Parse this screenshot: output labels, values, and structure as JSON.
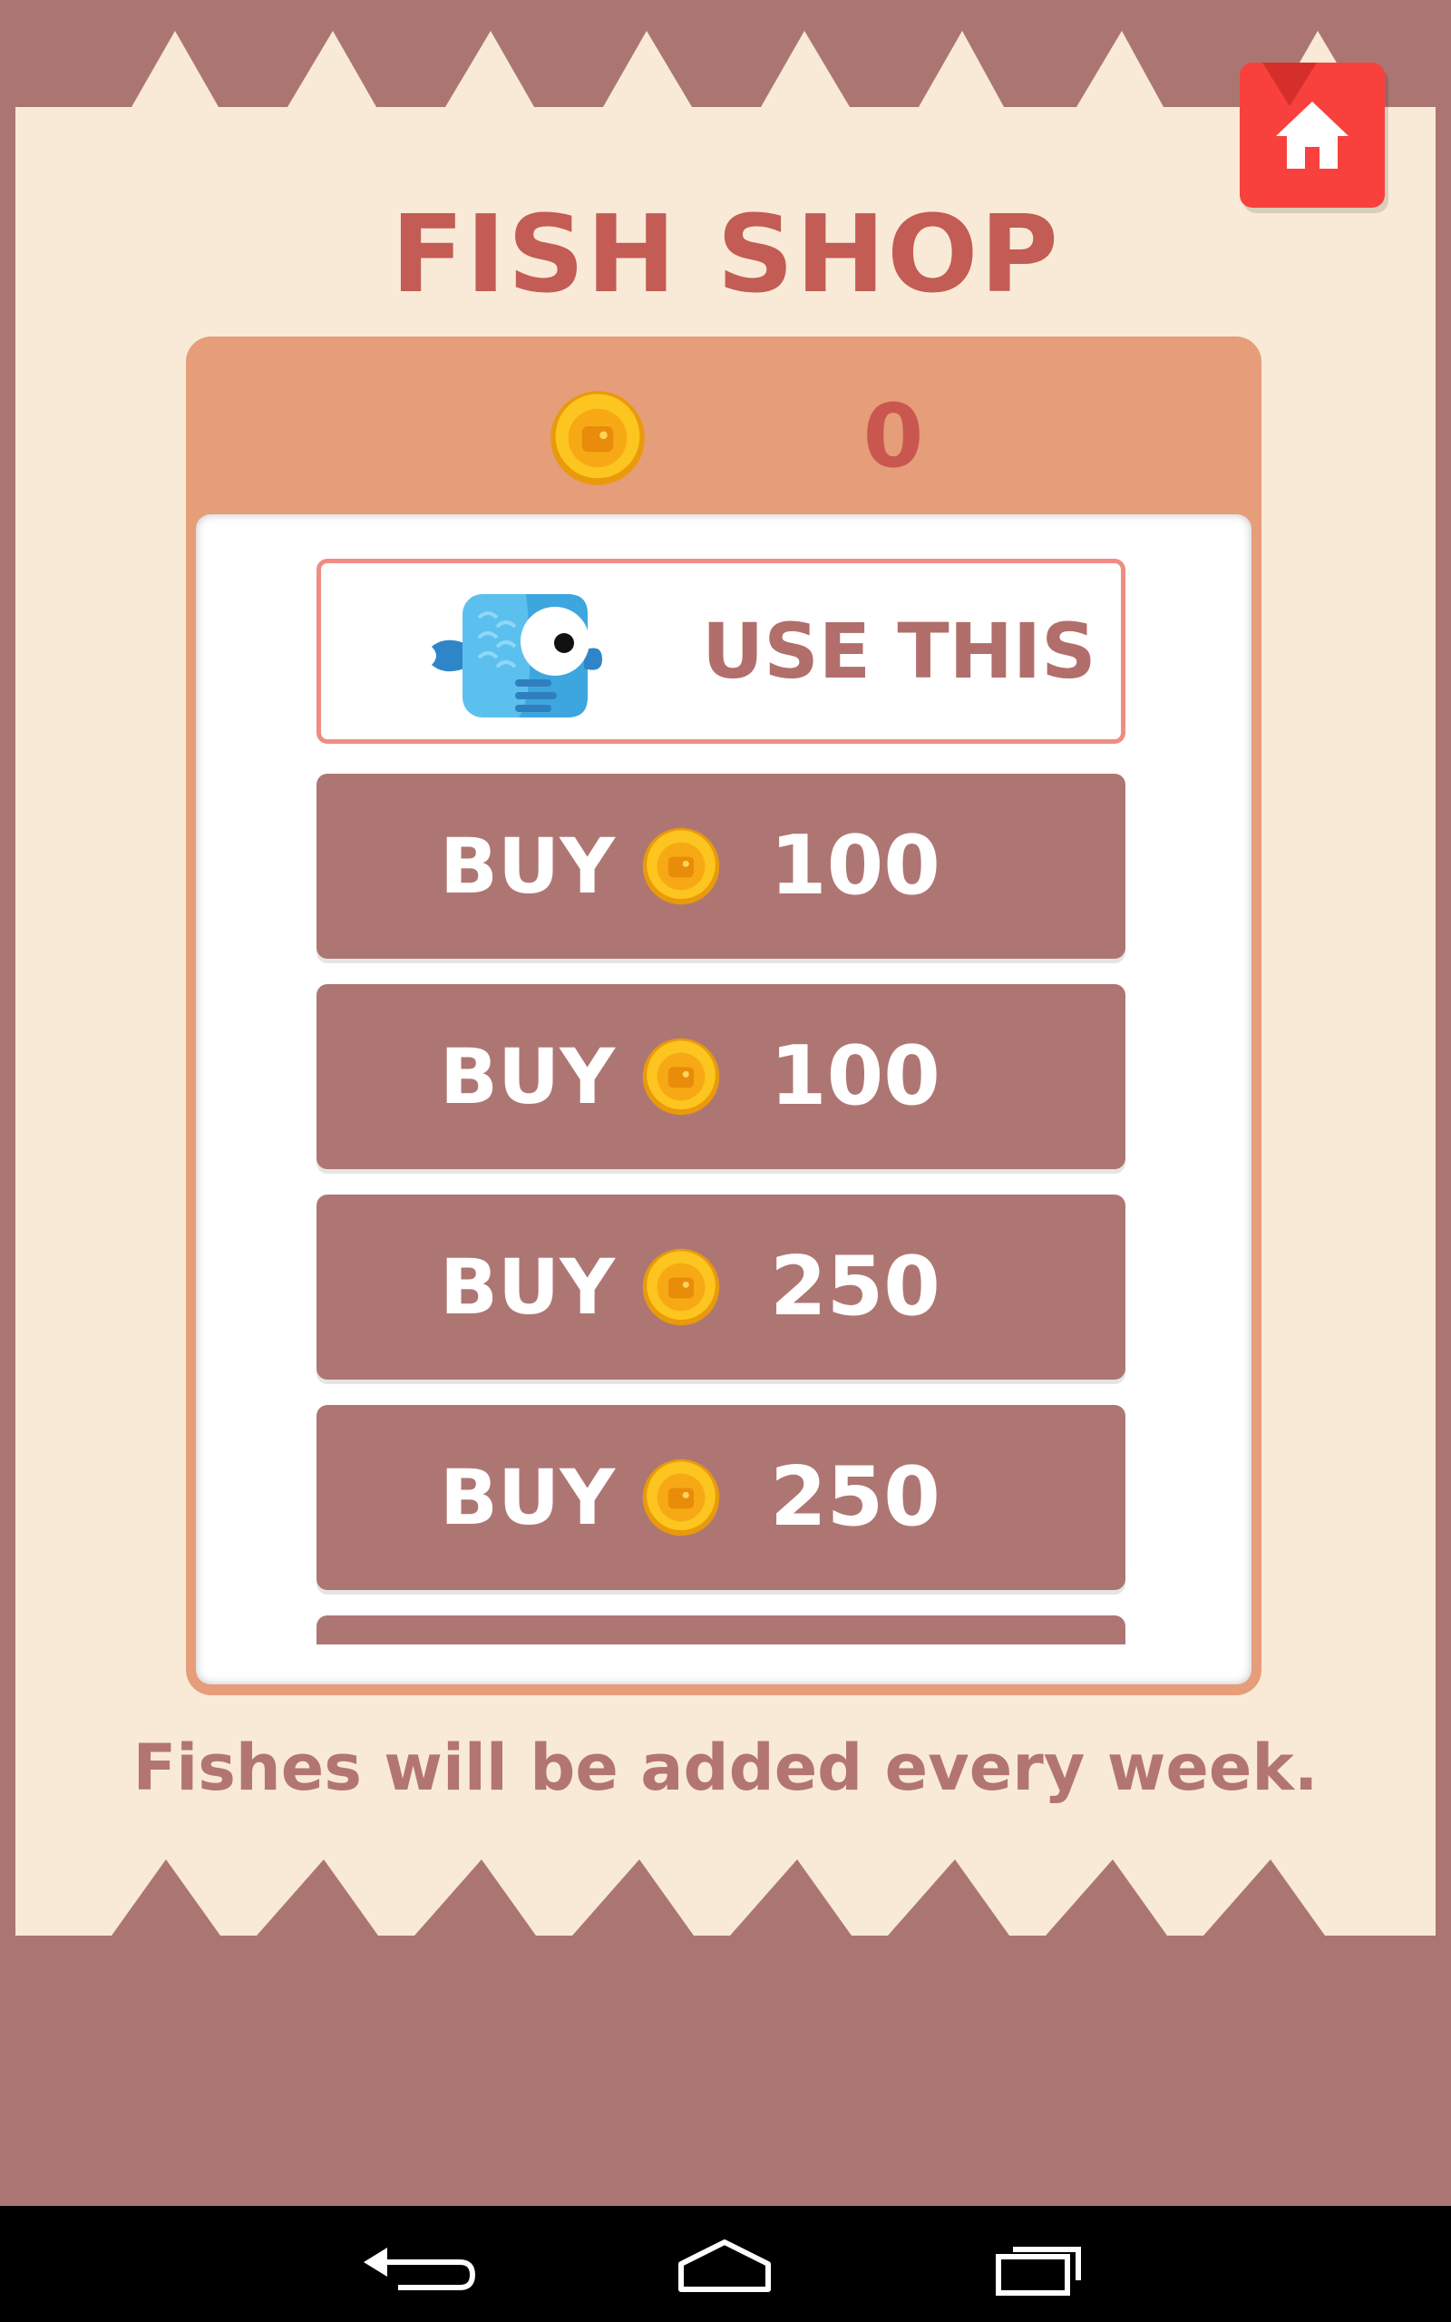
{
  "screen": {
    "title": "FISH SHOP",
    "footer_note": "Fishes will be added every week."
  },
  "wallet": {
    "coins": "0",
    "icon": "coin-icon"
  },
  "header": {
    "home_icon": "home-icon"
  },
  "items": [
    {
      "kind": "owned",
      "action_label": "USE THIS",
      "icon": "blue-fish-icon"
    },
    {
      "kind": "locked",
      "action_label": "BUY",
      "price": "100",
      "icon": "coin-icon"
    },
    {
      "kind": "locked",
      "action_label": "BUY",
      "price": "100",
      "icon": "coin-icon"
    },
    {
      "kind": "locked",
      "action_label": "BUY",
      "price": "250",
      "icon": "coin-icon"
    },
    {
      "kind": "locked",
      "action_label": "BUY",
      "price": "250",
      "icon": "coin-icon"
    }
  ],
  "nav": {
    "back_icon": "back-icon",
    "home_icon": "home-outline-icon",
    "recents_icon": "recent-apps-icon"
  },
  "colors": {
    "background": "#ab7672",
    "card": "#f8ead7",
    "title": "#c35c54",
    "panel": "#e69d79",
    "buy_button": "#ae7673",
    "home_button": "#f8413c",
    "coin": "#fbb818"
  }
}
